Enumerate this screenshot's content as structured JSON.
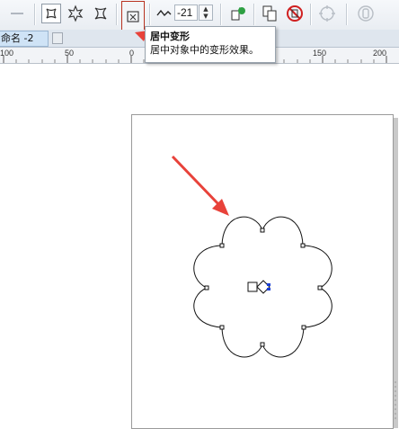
{
  "toolbar": {
    "amplitude_value": "-21",
    "spin_up": "▲",
    "spin_down": "▼",
    "buttons": [
      "pen-icon",
      "push-pull-icon",
      "zipper-icon",
      "twister-icon",
      "center-distortion-icon",
      "wave-icon",
      "convert-distortion-icon",
      "copy-properties-icon",
      "clear-distortion-icon",
      "frozen-icon",
      "lock-icon"
    ]
  },
  "tabs": {
    "document_tab": "命名 -2"
  },
  "ruler": {
    "labels": [
      "100",
      "50",
      "0",
      "150",
      "200"
    ]
  },
  "tooltip": {
    "title": "居中变形",
    "description": "居中对象中的变形效果。"
  },
  "colors": {
    "highlight_border": "#b8321f",
    "arrow": "#e8423a",
    "handle_blue": "#1a3fd6"
  }
}
